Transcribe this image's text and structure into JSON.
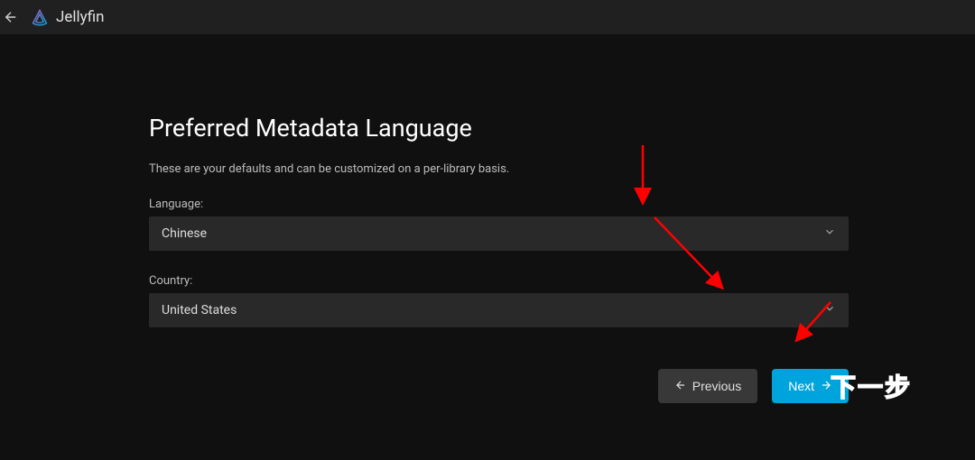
{
  "header": {
    "app_name": "Jellyfin"
  },
  "page": {
    "title": "Preferred Metadata Language",
    "subtitle": "These are your defaults and can be customized on a per-library basis."
  },
  "form": {
    "language": {
      "label": "Language:",
      "value": "Chinese"
    },
    "country": {
      "label": "Country:",
      "value": "United States"
    }
  },
  "buttons": {
    "previous": "Previous",
    "next": "Next"
  },
  "annotation": {
    "next_label": "下一步"
  }
}
